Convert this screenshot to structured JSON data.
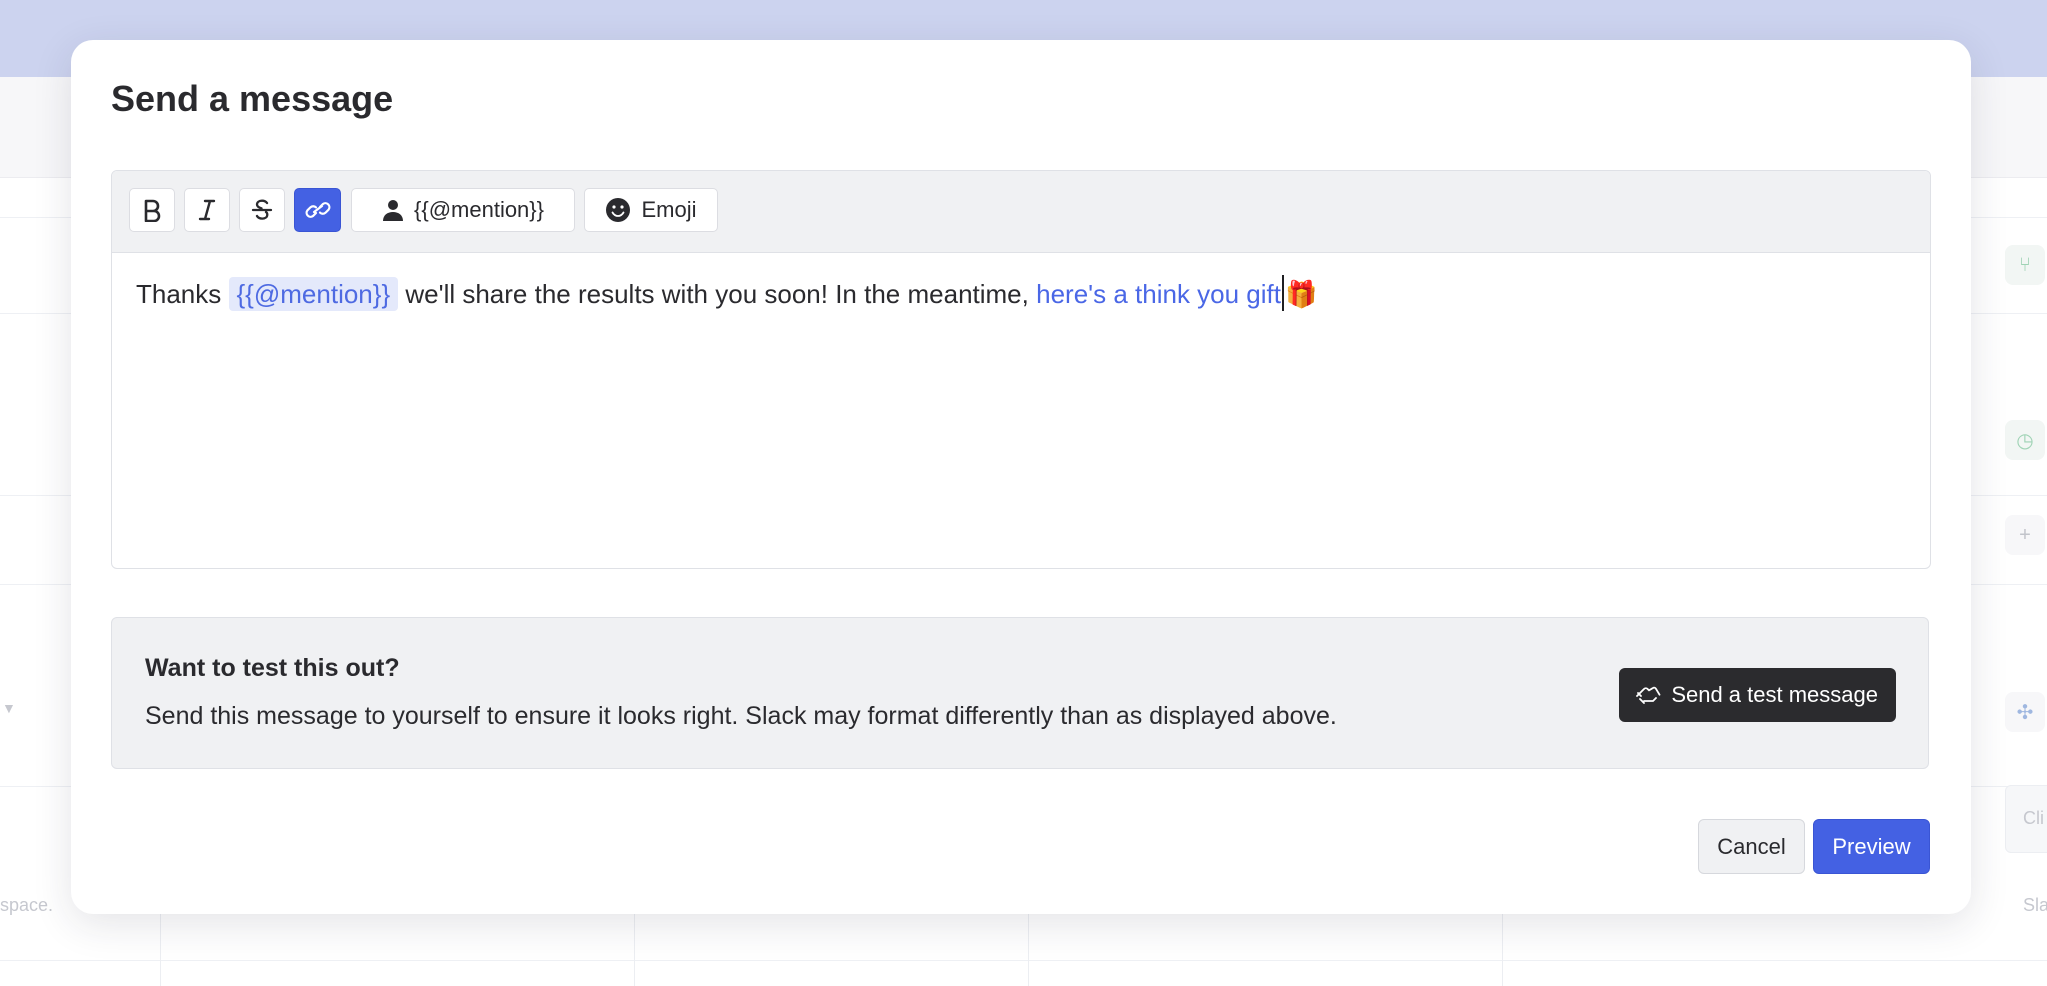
{
  "background": {
    "left_fragment": "space.",
    "right_fragment_1": "Cli",
    "right_fragment_2": "Sla"
  },
  "modal": {
    "title": "Send a message"
  },
  "toolbar": {
    "bold_icon": "bold-icon",
    "italic_icon": "italic-icon",
    "strike_icon": "strikethrough-icon",
    "link_icon": "link-icon",
    "mention_label": "{{@mention}}",
    "emoji_label": "Emoji"
  },
  "editor": {
    "text_before": "Thanks",
    "mention": "{{@mention}}",
    "text_middle": "we'll share the results with you soon! In the meantime,",
    "link_text": "here's a think you gift",
    "emoji": "🎁"
  },
  "test": {
    "title": "Want to test this out?",
    "description": "Send this message to yourself to ensure it looks right. Slack may format differently than as displayed above.",
    "button_label": "Send a test message"
  },
  "footer": {
    "cancel_label": "Cancel",
    "preview_label": "Preview"
  },
  "colors": {
    "accent": "#4461e3",
    "dark_button": "#2b2b2e",
    "panel": "#f0f1f3",
    "mention_bg": "#e4e9fb"
  }
}
